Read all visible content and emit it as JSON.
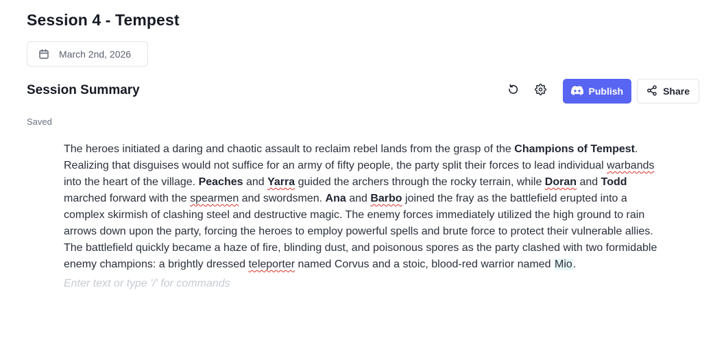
{
  "page": {
    "title": "Session 4 - Tempest",
    "date": "March 2nd, 2026"
  },
  "section": {
    "title": "Session Summary",
    "status": "Saved"
  },
  "toolbar": {
    "publish_label": "Publish",
    "share_label": "Share",
    "publish_color": "#5865f2",
    "icons": [
      "refresh-icon",
      "gear-icon",
      "discord-icon",
      "share-icon"
    ]
  },
  "editor": {
    "segments": [
      "The heroes initiated a daring and chaotic assault to reclaim rebel lands from the grasp of the ",
      "Champions of Tempest",
      ". Realizing that disguises would not suffice for an army of fifty people, the party split their forces to lead individual ",
      "warbands",
      " into the heart of the village. ",
      "Peaches",
      " and ",
      "Yarra",
      " guided the archers through the rocky terrain, while ",
      "Doran",
      " and ",
      "Todd",
      " marched forward with the ",
      "spearmen",
      " and swordsmen. ",
      "Ana",
      " and ",
      "Barbo",
      " joined the fray as the battlefield erupted into a complex skirmish of clashing steel and destructive magic. The enemy forces immediately utilized the high ground to rain arrows down upon the party, forcing the heroes to employ powerful spells and brute force to protect their vulnerable allies. The battlefield quickly became a haze of fire, blinding dust, and poisonous spores as the party clashed with two formidable enemy champions: a brightly dressed ",
      "teleporter",
      " named Corvus and a stoic, blood-red warrior named ",
      "Mio",
      "."
    ],
    "placeholder": "Enter text or type '/' for commands"
  }
}
